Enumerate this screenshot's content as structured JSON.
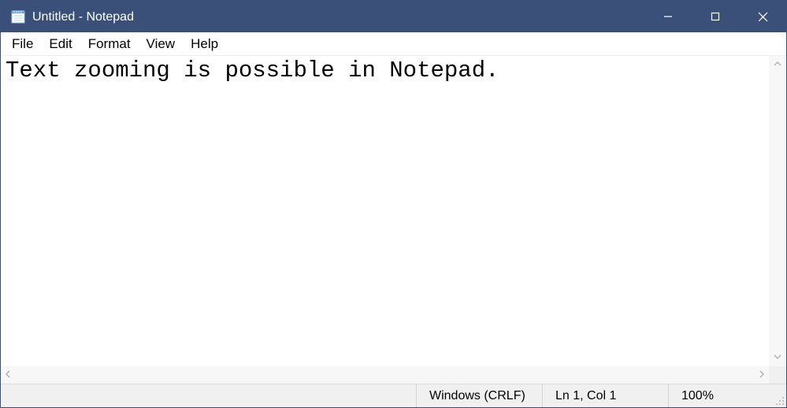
{
  "titlebar": {
    "title": "Untitled - Notepad"
  },
  "menu": {
    "file": "File",
    "edit": "Edit",
    "format": "Format",
    "view": "View",
    "help": "Help"
  },
  "editor": {
    "content": "Text zooming is possible in Notepad."
  },
  "statusbar": {
    "encoding": "Windows (CRLF)",
    "position": "Ln 1, Col 1",
    "zoom": "100%"
  }
}
